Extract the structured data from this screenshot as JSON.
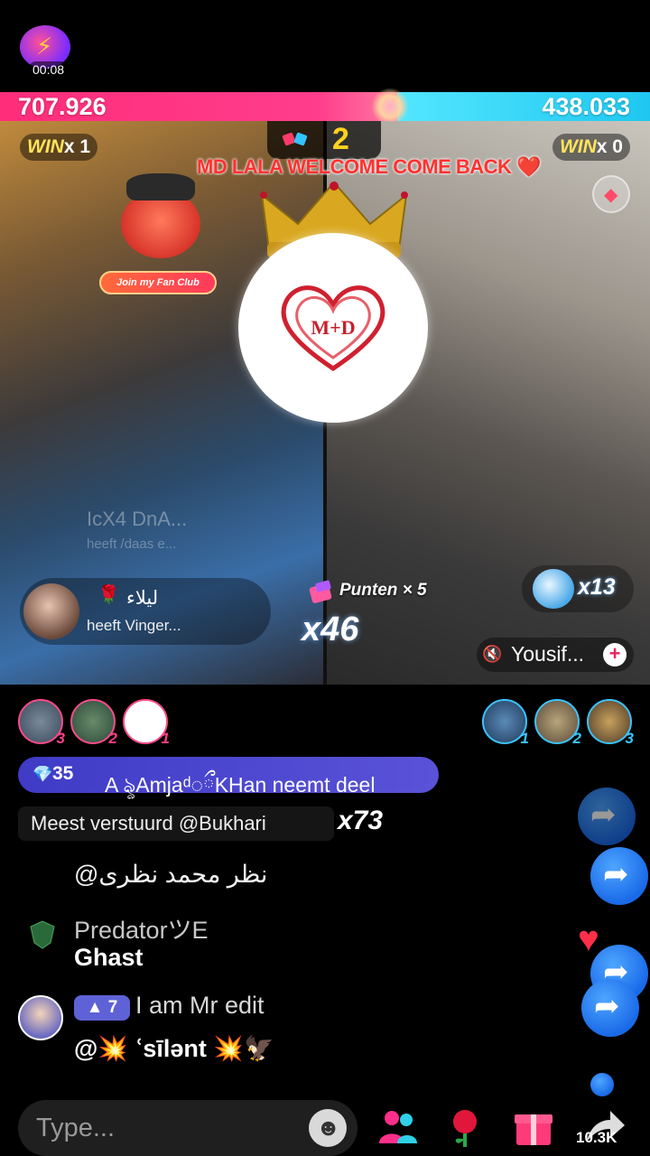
{
  "timer": "00:08",
  "battle": {
    "left_score": "707.926",
    "right_score": "438.033",
    "left_win": "x 1",
    "right_win": "x 0",
    "win_label": "WIN",
    "round": "2"
  },
  "welcome_text": "MD LALA WELCOME COME BACK ❤️",
  "fanclub_tag": "Join my Fan Club",
  "logo_text": "M+D",
  "faded_join": "IcX4 DnA...",
  "faded_join2": "heeft /daas e...",
  "gift_notice": {
    "name": "ليلاء",
    "message": "heeft Vinger..."
  },
  "points_label": "Punten × 5",
  "combo_left": "x46",
  "combo_right": "x13",
  "cohost_name": "Yousif...",
  "viewers_left": [
    "3",
    "2",
    "1"
  ],
  "viewers_right": [
    "1",
    "2",
    "3"
  ],
  "join_notice": {
    "level": "35",
    "text": "A ৡAmjaᵈ◌ྀKHan neemt deel"
  },
  "top_sender": "Meest verstuurd @Bukhari",
  "top_sender_combo": "x73",
  "chat": {
    "arabic_line": "@نظر محمد نظری",
    "predator_name": "PredatorツE",
    "predator_msg": "Ghast",
    "editor_level": "7",
    "editor_name": "I am Mr edit",
    "editor_msg": "@💥 ՙsīlənt 💥🦅"
  },
  "input": {
    "placeholder": "Type..."
  },
  "share_count": "10.3K",
  "colors": {
    "red_team": "#ff2d7a",
    "blue_team": "#1fc7f0",
    "join_pill": "#4a45cf"
  }
}
